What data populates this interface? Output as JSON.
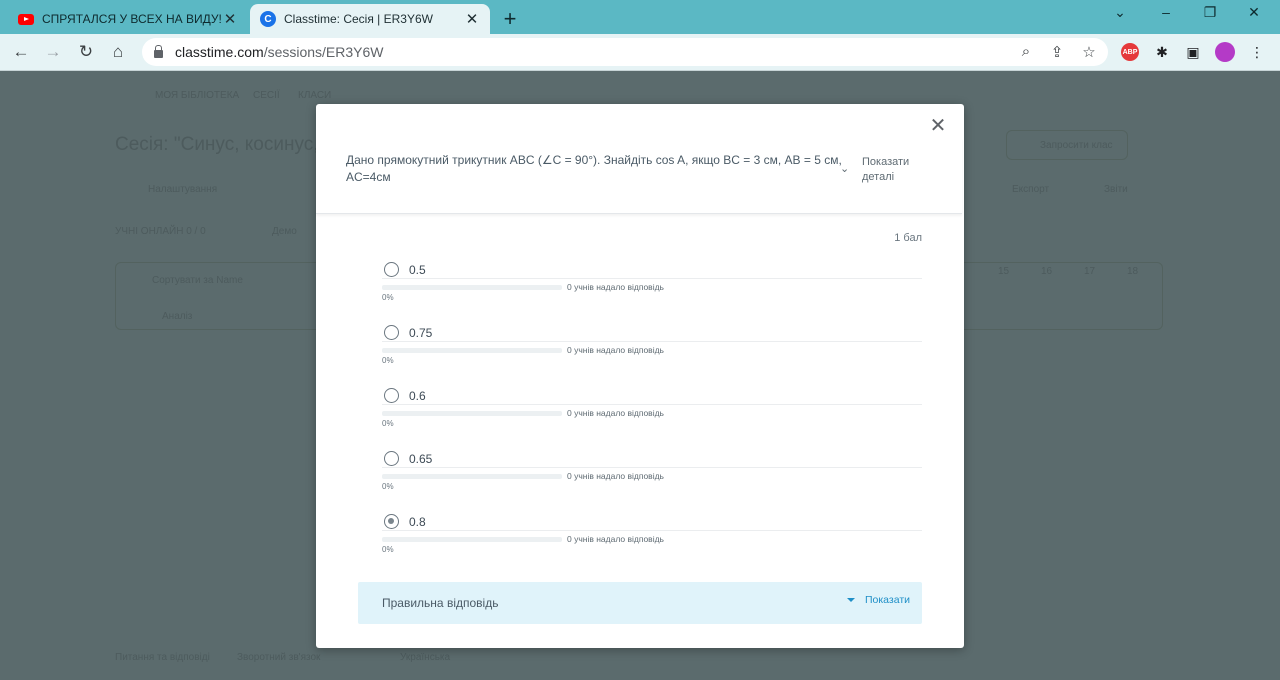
{
  "browser": {
    "tabs": [
      {
        "title": "СПРЯТАЛСЯ У ВСЕХ НА ВИДУ! Н",
        "favicon": "youtube-icon"
      },
      {
        "title": "Classtime: Сесія | ER3Y6W",
        "favicon": "classtime-icon"
      }
    ],
    "url_host": "classtime.com",
    "url_path": "/sessions/ER3Y6W",
    "abp_label": "ABP"
  },
  "modal": {
    "question": "Дано прямокутний трикутник ABC (∠C = 90°). Знайдіть cos A, якщо BC = 3 см, AB = 5 см, AC=4см",
    "details_label": "Показати деталі",
    "points": "1 бал",
    "options": [
      {
        "label": "0.5",
        "count_text": "0 учнів надало відповідь",
        "percent_text": "0%",
        "percent": 0,
        "checked": false
      },
      {
        "label": "0.75",
        "count_text": "0 учнів надало відповідь",
        "percent_text": "0%",
        "percent": 0,
        "checked": false
      },
      {
        "label": "0.6",
        "count_text": "0 учнів надало відповідь",
        "percent_text": "0%",
        "percent": 0,
        "checked": false
      },
      {
        "label": "0.65",
        "count_text": "0 учнів надало відповідь",
        "percent_text": "0%",
        "percent": 0,
        "checked": false
      },
      {
        "label": "0.8",
        "count_text": "0 учнів надало відповідь",
        "percent_text": "0%",
        "percent": 0,
        "checked": true
      }
    ],
    "correct_answer_label": "Правильна відповідь",
    "show_label": "Показати"
  },
  "background": {
    "nav_items": [
      "МОЯ БІБЛІОТЕКА",
      "СЕСІЇ",
      "КЛАСИ"
    ],
    "session_title": "Сесія: \"Синус, косинус,",
    "toolbar_left": "Налаштування",
    "students_online": "УЧНІ ОНЛАЙН 0 / 0",
    "demo_toggle": "Демо",
    "sort_label": "Сортувати за Name",
    "column_label": "Аналіз",
    "invite_button": "Запросити клас",
    "export_label": "Експорт",
    "review_label": "Звіти",
    "column_numbers": [
      "15",
      "16",
      "17",
      "18"
    ],
    "footer": [
      "Питання та відповіді",
      "Зворотний зв'язок",
      "Українська"
    ]
  }
}
